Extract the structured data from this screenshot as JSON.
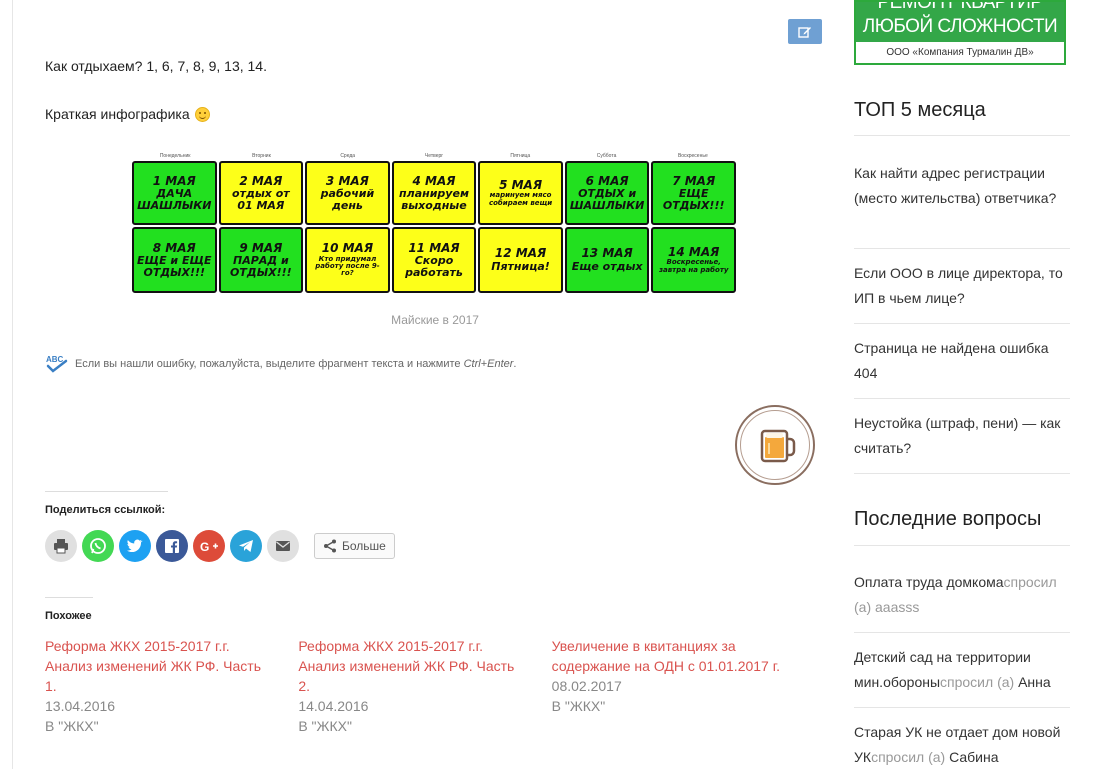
{
  "article": {
    "rest_line": "Как отдыхаем? 1, 6, 7, 8, 9, 13, 14.",
    "infographic_intro": "Краткая инфографика",
    "calendar": {
      "weekdays": [
        "Понедельник",
        "Вторник",
        "Среда",
        "Четверг",
        "Пятница",
        "Суббота",
        "Воскресенье"
      ],
      "cells": [
        {
          "date": "1 МАЯ",
          "text": "ДАЧА ШАШЛЫКИ",
          "color": "#22e01f"
        },
        {
          "date": "2 МАЯ",
          "text": "отдых от 01 МАЯ",
          "color": "#fdff19"
        },
        {
          "date": "3 МАЯ",
          "text": "рабочий день",
          "color": "#fdff19"
        },
        {
          "date": "4 МАЯ",
          "text": "планируем выходные",
          "color": "#fdff19"
        },
        {
          "date": "5 МАЯ",
          "text": "маринуем мясо собираем вещи",
          "color": "#fdff19"
        },
        {
          "date": "6 МАЯ",
          "text": "ОТДЫХ и ШАШЛЫКИ",
          "color": "#22e01f"
        },
        {
          "date": "7 МАЯ",
          "text": "ЕЩЕ ОТДЫХ!!!",
          "color": "#22e01f"
        },
        {
          "date": "8 МАЯ",
          "text": "ЕЩЕ и ЕЩЕ ОТДЫХ!!!",
          "color": "#22e01f"
        },
        {
          "date": "9 МАЯ",
          "text": "ПАРАД и ОТДЫХ!!!",
          "color": "#22e01f"
        },
        {
          "date": "10 МАЯ",
          "text": "Кто придумал работу после 9-го?",
          "color": "#fdff19"
        },
        {
          "date": "11 МАЯ",
          "text": "Скоро работать",
          "color": "#fdff19"
        },
        {
          "date": "12 МАЯ",
          "text": "Пятница!",
          "color": "#fdff19"
        },
        {
          "date": "13 МАЯ",
          "text": "Еще отдых",
          "color": "#22e01f"
        },
        {
          "date": "14 МАЯ",
          "text": "Воскресенье, завтра на работу",
          "color": "#22e01f"
        }
      ]
    },
    "caption": "Майские в 2017",
    "spellcheck_text": "Если вы нашли ошибку, пожалуйста, выделите фрагмент текста и нажмите",
    "spellcheck_keys": "Ctrl+Enter",
    "share_title": "Поделиться ссылкой:",
    "share_buttons": [
      {
        "name": "print-icon",
        "color": "#e0e0e0"
      },
      {
        "name": "whatsapp-icon",
        "color": "#43d854"
      },
      {
        "name": "twitter-icon",
        "color": "#1da1f2"
      },
      {
        "name": "facebook-icon",
        "color": "#3b5998"
      },
      {
        "name": "google-plus-icon",
        "color": "#dd4b39"
      },
      {
        "name": "telegram-icon",
        "color": "#2aa3d9"
      },
      {
        "name": "email-icon",
        "color": "#e0e0e0"
      }
    ],
    "more_label": "Больше",
    "related_title": "Похожее",
    "related": [
      {
        "title": "Реформа ЖКХ 2015-2017 г.г. Анализ изменений ЖК РФ. Часть 1.",
        "date": "13.04.2016",
        "category": "В \"ЖКХ\""
      },
      {
        "title": "Реформа ЖКХ 2015-2017 г.г. Анализ изменений ЖК РФ. Часть 2.",
        "date": "14.04.2016",
        "category": "В \"ЖКХ\""
      },
      {
        "title": "Увеличение в квитанциях за содержание на ОДН с 01.01.2017 г.",
        "date": "08.02.2017",
        "category": "В \"ЖКХ\""
      }
    ]
  },
  "sidebar": {
    "banner": {
      "partial_line": "РЕМОНТ КВАРТИР",
      "main_line": "ЛЮБОЙ СЛОЖНОСТИ",
      "company": "ООО «Компания Турмалин ДВ»"
    },
    "top5_title": "ТОП 5 месяца",
    "top5": [
      "Как найти адрес регистрации (место жительства) ответчика?",
      "",
      "Если ООО в лице директора, то ИП в чьем лице?",
      "Страница не найдена ошибка 404",
      "Неустойка (штраф, пени) — как считать?"
    ],
    "questions_title": "Последние вопросы",
    "questions": [
      {
        "title": "Оплата труда домкома",
        "asked": "спросил (а)",
        "user": "aaasss"
      },
      {
        "title": "Детский сад на территории мин.обороны",
        "asked": "спросил (а)",
        "user": "Анна"
      },
      {
        "title": "Старая УК не отдает дом новой УК",
        "asked": "спросил (а)",
        "user": "Сабина"
      }
    ]
  }
}
